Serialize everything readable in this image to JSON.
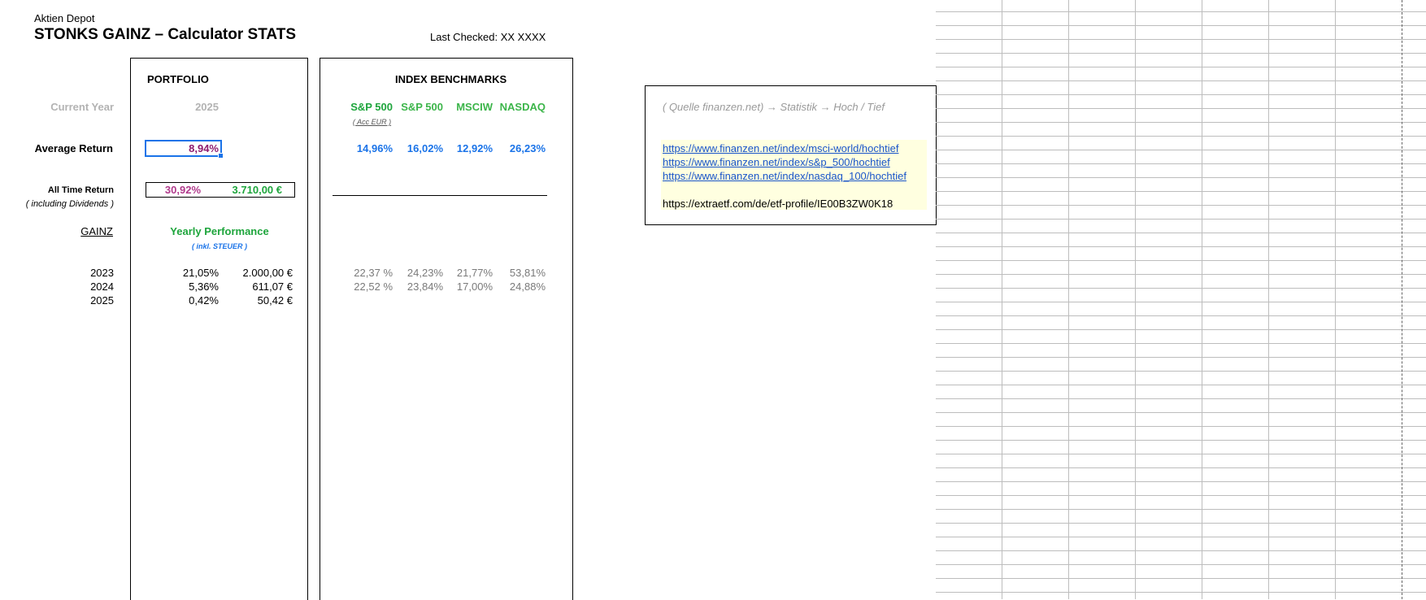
{
  "header": {
    "subtitle": "Aktien Depot",
    "title": "STONKS GAINZ – Calculator STATS",
    "last_checked": "Last Checked: XX XXXX"
  },
  "portfolio": {
    "heading": "PORTFOLIO",
    "current_year_label": "Current Year",
    "current_year_value": "2025",
    "average_return_label": "Average Return",
    "average_return_value": "8,94%",
    "all_time_label": "All Time Return",
    "all_time_sub": "( including Dividends )",
    "all_time_pct": "30,92%",
    "all_time_eur": "3.710,00 €",
    "gainz_label": "GAINZ",
    "yearly_perf_label": "Yearly Performance",
    "yearly_perf_sub": "( inkl. STEUER )",
    "rows": [
      {
        "year": "2023",
        "pct": "21,05%",
        "eur": "2.000,00 €"
      },
      {
        "year": "2024",
        "pct": "5,36%",
        "eur": "611,07 €"
      },
      {
        "year": "2025",
        "pct": "0,42%",
        "eur": "50,42 €"
      }
    ]
  },
  "benchmarks": {
    "heading": "INDEX BENCHMARKS",
    "columns": [
      {
        "name": "S&P 500",
        "sub": "( Acc EUR )",
        "average": "14,96%",
        "y2023": "22,37 %",
        "y2024": "22,52 %"
      },
      {
        "name": "S&P 500",
        "sub": "",
        "average": "16,02%",
        "y2023": "24,23%",
        "y2024": "23,84%"
      },
      {
        "name": "MSCIW",
        "sub": "",
        "average": "12,92%",
        "y2023": "21,77%",
        "y2024": "17,00%"
      },
      {
        "name": "NASDAQ",
        "sub": "",
        "average": "26,23%",
        "y2023": "53,81%",
        "y2024": "24,88%"
      }
    ]
  },
  "sources": {
    "note": "( Quelle finanzen.net) → Statistik → Hoch / Tief",
    "links": [
      "https://www.finanzen.net/index/msci-world/hochtief",
      "https://www.finanzen.net/index/s&p_500/hochtief",
      "https://www.finanzen.net/index/nasdaq_100/hochtief"
    ],
    "etf_link": "https://extraetf.com/de/etf-profile/IE00B3ZW0K18"
  },
  "colors": {
    "accent_blue": "#1a73e8",
    "green": "#1ea53c",
    "purple": "#8e1a6e",
    "highlight_yellow": "#ffffe0"
  }
}
